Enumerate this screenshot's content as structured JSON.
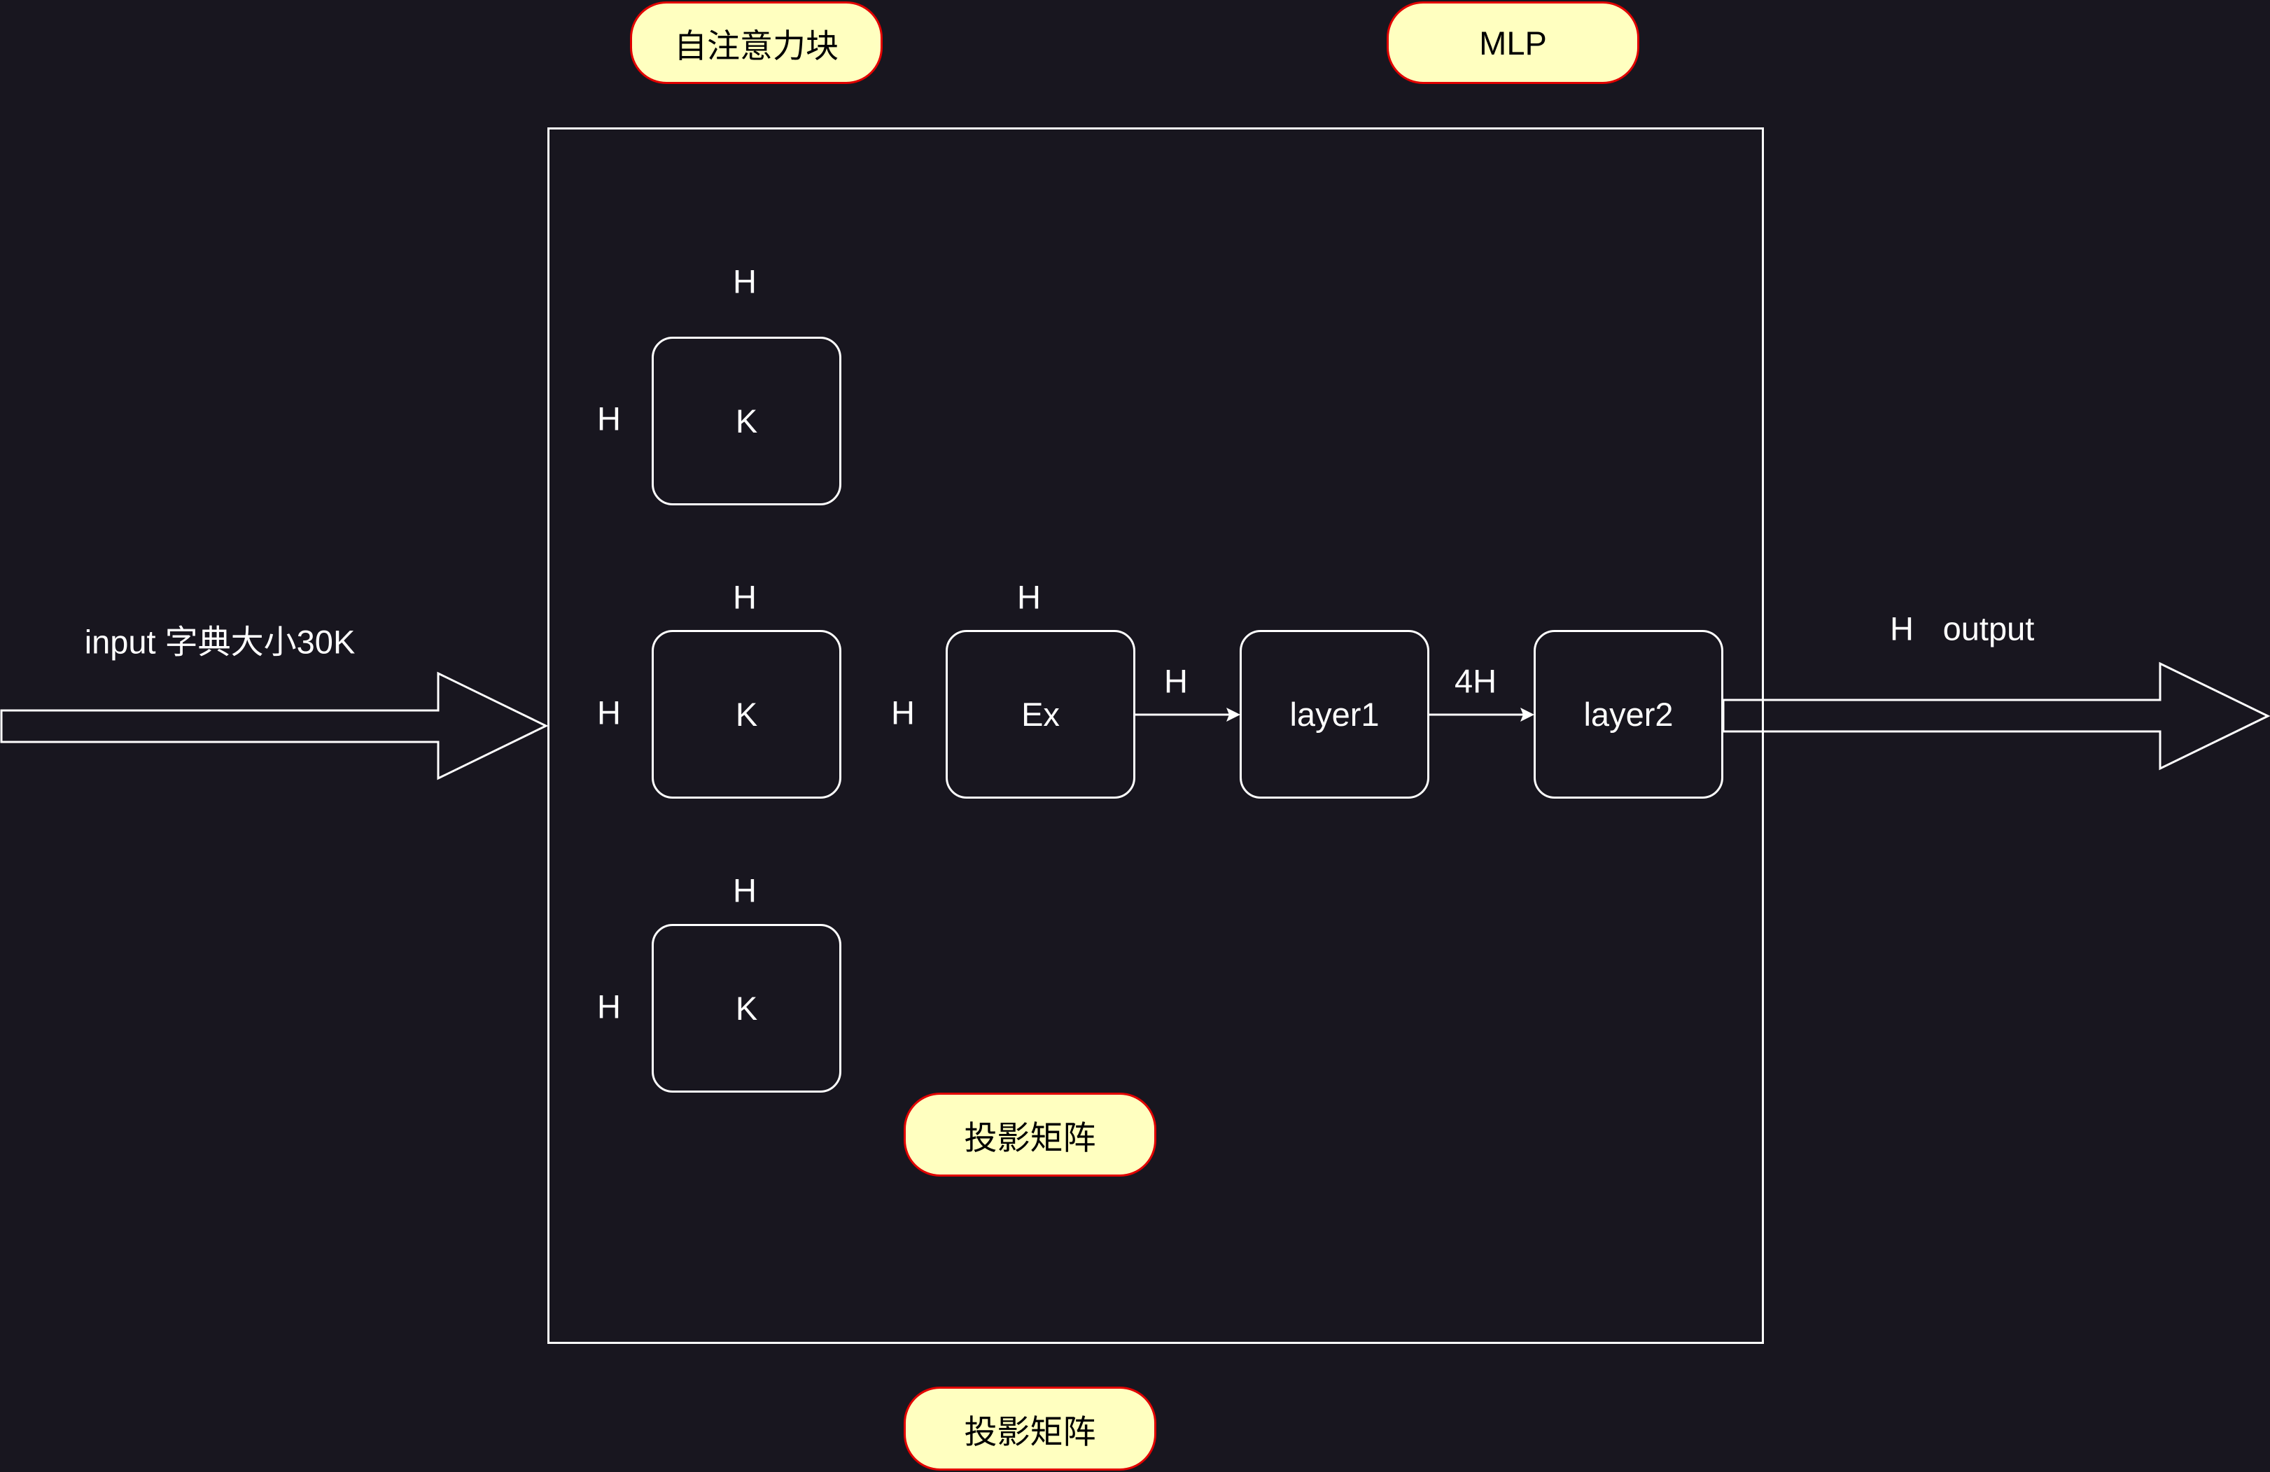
{
  "pills": {
    "self_attention": "自注意力块",
    "mlp": "MLP",
    "projection_inner": "投影矩阵",
    "projection_outer": "投影矩阵"
  },
  "nodes": {
    "k_top": "K",
    "k_mid": "K",
    "k_bot": "K",
    "ex": "Ex",
    "layer1": "layer1",
    "layer2": "layer2"
  },
  "dims": {
    "k_top_above": "H",
    "k_top_left": "H",
    "k_mid_above": "H",
    "k_mid_left": "H",
    "k_bot_above": "H",
    "k_bot_left": "H",
    "ex_above": "H",
    "ex_left": "H",
    "ex_to_layer1": "H",
    "layer1_to_layer2": "4H"
  },
  "input_label": "input 字典大小30K",
  "output": {
    "dim": "H",
    "label": "output"
  },
  "colors": {
    "background": "#18161f",
    "stroke": "#ffffff",
    "pill_fill": "#ffffc0",
    "pill_border": "#e10000"
  }
}
